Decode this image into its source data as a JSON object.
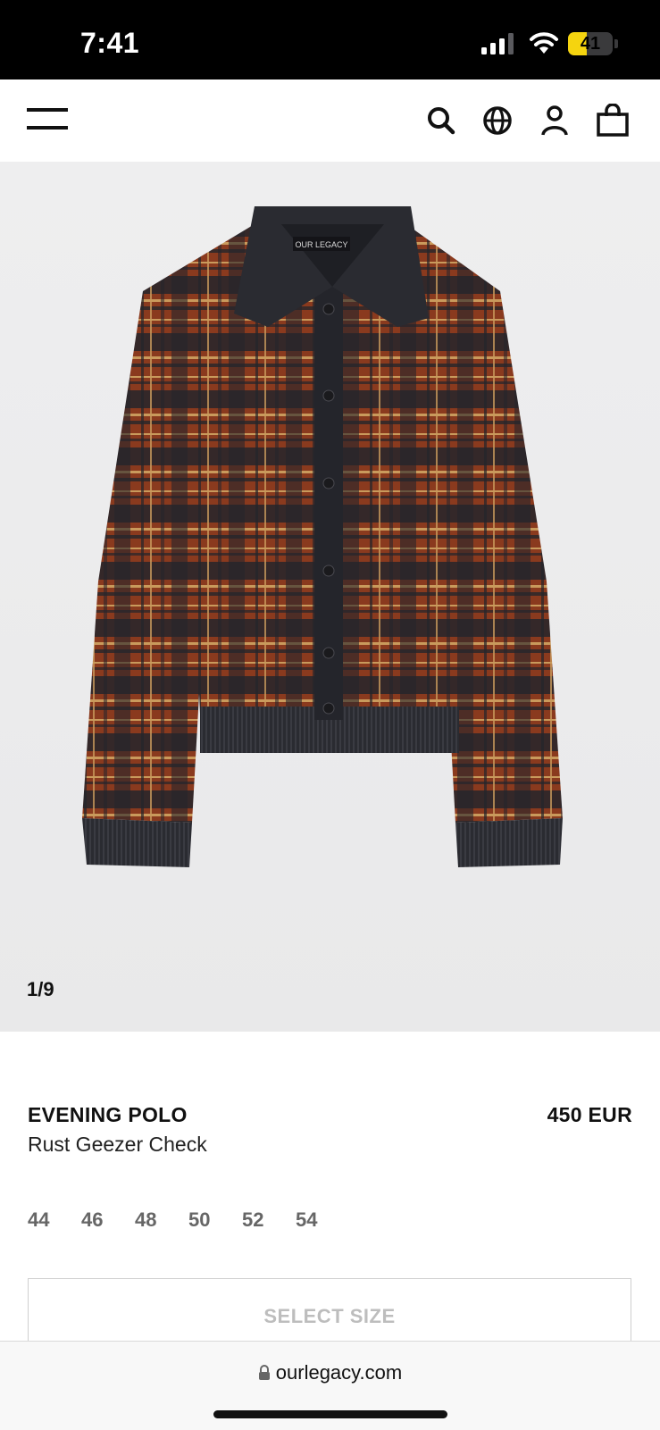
{
  "status_bar": {
    "time": "7:41",
    "battery_level": "41",
    "battery_fraction": 0.41
  },
  "header": {
    "icons": [
      "menu-icon",
      "search-icon",
      "globe-icon",
      "account-icon",
      "shopping-bag-icon"
    ]
  },
  "gallery": {
    "counter": "1/9",
    "brand_label": "OUR LEGACY",
    "colors": {
      "rust": "#8a3a1e",
      "charcoal": "#24252b",
      "tan": "#c99a5c"
    }
  },
  "product": {
    "name": "EVENING POLO",
    "variant": "Rust Geezer Check",
    "price": "450 EUR",
    "sizes": [
      "44",
      "46",
      "48",
      "50",
      "52",
      "54"
    ],
    "select_size_label": "SELECT SIZE"
  },
  "browser": {
    "url": "ourlegacy.com"
  }
}
